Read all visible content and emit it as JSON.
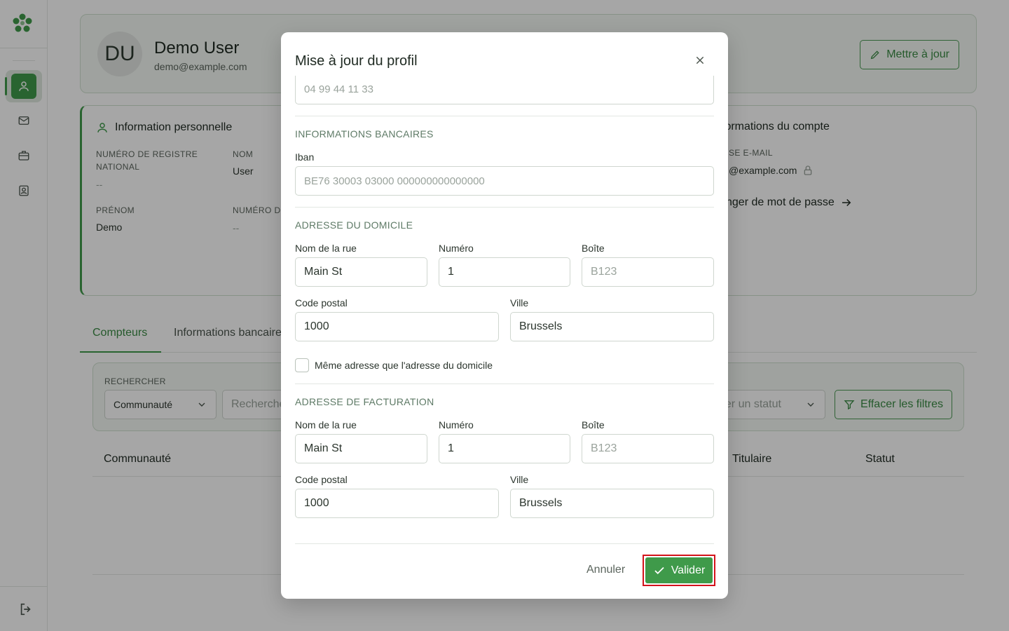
{
  "profile": {
    "initials": "DU",
    "name": "Demo User",
    "email": "demo@example.com",
    "update_label": "Mettre à jour"
  },
  "personal": {
    "title": "Information personnelle",
    "registry_label_line1": "NUMÉRO DE REGISTRE",
    "registry_label_line2": "NATIONAL",
    "registry_value": "--",
    "lastname_label": "NOM",
    "lastname_value": "User",
    "firstname_label": "PRÉNOM",
    "firstname_value": "Demo",
    "number_label": "NUMÉRO D",
    "number_value": "--"
  },
  "account": {
    "title": "formations du compte",
    "email_label": "SE E-MAIL",
    "email_value": "@example.com",
    "password_link": "nger de mot de passe"
  },
  "tabs": {
    "meters": "Compteurs",
    "banking": "Informations bancaire"
  },
  "filters": {
    "search_label": "RECHERCHER",
    "community_select": "Communauté",
    "search_placeholder": "Recherche",
    "status_select": "ner un statut",
    "clear_label": "Effacer les filtres"
  },
  "table": {
    "col_community": "Communauté",
    "col_holder": "Titulaire",
    "col_status": "Statut"
  },
  "modal": {
    "title": "Mise à jour du profil",
    "phone_value": "04 99 44 11 33",
    "banking_section": "INFORMATIONS BANCAIRES",
    "iban_label": "Iban",
    "iban_placeholder": "BE76 30003 03000 000000000000000",
    "home_section": "ADRESSE DU DOMICILE",
    "street_label": "Nom de la rue",
    "number_label": "Numéro",
    "box_label": "Boîte",
    "postal_label": "Code postal",
    "city_label": "Ville",
    "home_street": "Main St",
    "home_number": "1",
    "home_box_placeholder": "B123",
    "home_postal": "1000",
    "home_city": "Brussels",
    "same_address_label": "Même adresse que l'adresse du domicile",
    "billing_section": "ADRESSE DE FACTURATION",
    "billing_street": "Main St",
    "billing_number": "1",
    "billing_box_placeholder": "B123",
    "billing_postal": "1000",
    "billing_city": "Brussels",
    "cancel_label": "Annuler",
    "validate_label": "Valider"
  },
  "colors": {
    "brand_green": "#3f9a4a",
    "highlight_red": "#d3121b"
  }
}
